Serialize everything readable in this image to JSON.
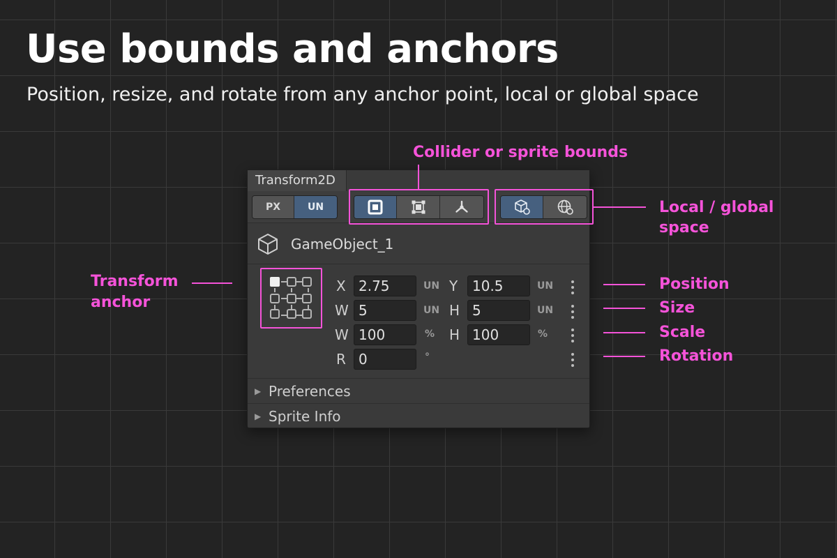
{
  "headline": "Use bounds and anchors",
  "subtitle": "Position, resize, and rotate from any anchor point, local or global space",
  "accent_color": "#f553d9",
  "callouts": {
    "bounds": "Collider or sprite bounds",
    "space_line1": "Local / global",
    "space_line2": "space",
    "anchor_line1": "Transform",
    "anchor_line2": "anchor",
    "position": "Position",
    "size": "Size",
    "scale": "Scale",
    "rotation": "Rotation"
  },
  "panel": {
    "tab_title": "Transform2D",
    "unit_toggle": {
      "px": "PX",
      "un": "UN",
      "selected": "UN"
    },
    "bounds_buttons": [
      "square-bounds-icon",
      "vertex-bounds-icon",
      "pivot-icon"
    ],
    "space_buttons": [
      "local-cube-icon",
      "global-globe-icon"
    ],
    "object_name": "GameObject_1",
    "position": {
      "x_label": "X",
      "x": "2.75",
      "x_unit": "UN",
      "y_label": "Y",
      "y": "10.5",
      "y_unit": "UN"
    },
    "size": {
      "w_label": "W",
      "w": "5",
      "w_unit": "UN",
      "h_label": "H",
      "h": "5",
      "h_unit": "UN"
    },
    "scale": {
      "w_label": "W",
      "w": "100",
      "w_unit": "%",
      "h_label": "H",
      "h": "100",
      "h_unit": "%"
    },
    "rotation": {
      "r_label": "R",
      "r": "0",
      "r_unit": "°"
    },
    "sections": [
      "Preferences",
      "Sprite Info"
    ]
  }
}
